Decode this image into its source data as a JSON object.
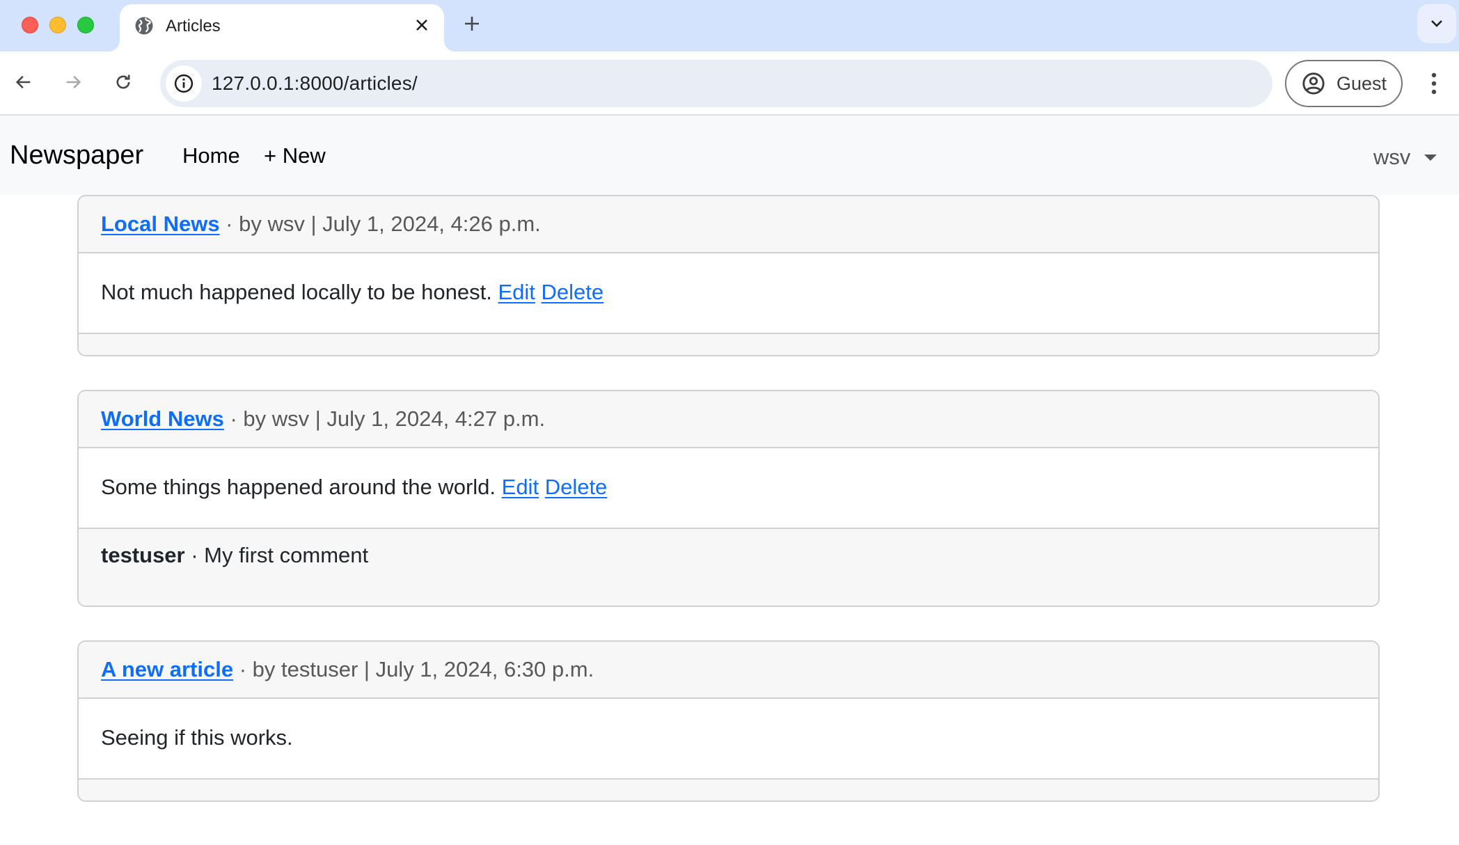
{
  "browser": {
    "tab": {
      "title": "Articles",
      "favicon": "globe-icon"
    },
    "url": "127.0.0.1:8000/articles/",
    "profile_label": "Guest",
    "icons": {
      "back": "arrow-left-icon",
      "forward": "arrow-right-icon",
      "reload": "reload-icon",
      "site_info": "info-icon",
      "profile": "account-circle-icon",
      "menu": "kebab-menu-icon",
      "close_tab": "close-icon",
      "new_tab": "plus-icon",
      "tab_search": "chevron-down-icon"
    }
  },
  "site_nav": {
    "brand": "Newspaper",
    "links": [
      {
        "label": "Home"
      },
      {
        "label": "+ New"
      }
    ],
    "user": "wsv"
  },
  "articles": [
    {
      "title": "Local News",
      "meta_sep": " · by ",
      "author": "wsv",
      "date_sep": " | ",
      "date": "July 1, 2024, 4:26 p.m.",
      "body": "Not much happened locally to be honest.",
      "edit_label": "Edit",
      "delete_label": "Delete",
      "comments": []
    },
    {
      "title": "World News",
      "meta_sep": " · by ",
      "author": "wsv",
      "date_sep": " | ",
      "date": "July 1, 2024, 4:27 p.m.",
      "body": "Some things happened around the world.",
      "edit_label": "Edit",
      "delete_label": "Delete",
      "comments": [
        {
          "author": "testuser",
          "sep": " · ",
          "text": "My first comment"
        }
      ]
    },
    {
      "title": "A new article",
      "meta_sep": " · by ",
      "author": "testuser",
      "date_sep": " | ",
      "date": "July 1, 2024, 6:30 p.m.",
      "body": "Seeing if this works.",
      "comments": []
    }
  ],
  "colors": {
    "link": "#0d6efd",
    "tabstrip_bg": "#d3e3fd",
    "navbar_bg": "#f8f9fa",
    "card_header_bg": "#f7f7f7",
    "card_border": "#d0d0d0"
  }
}
